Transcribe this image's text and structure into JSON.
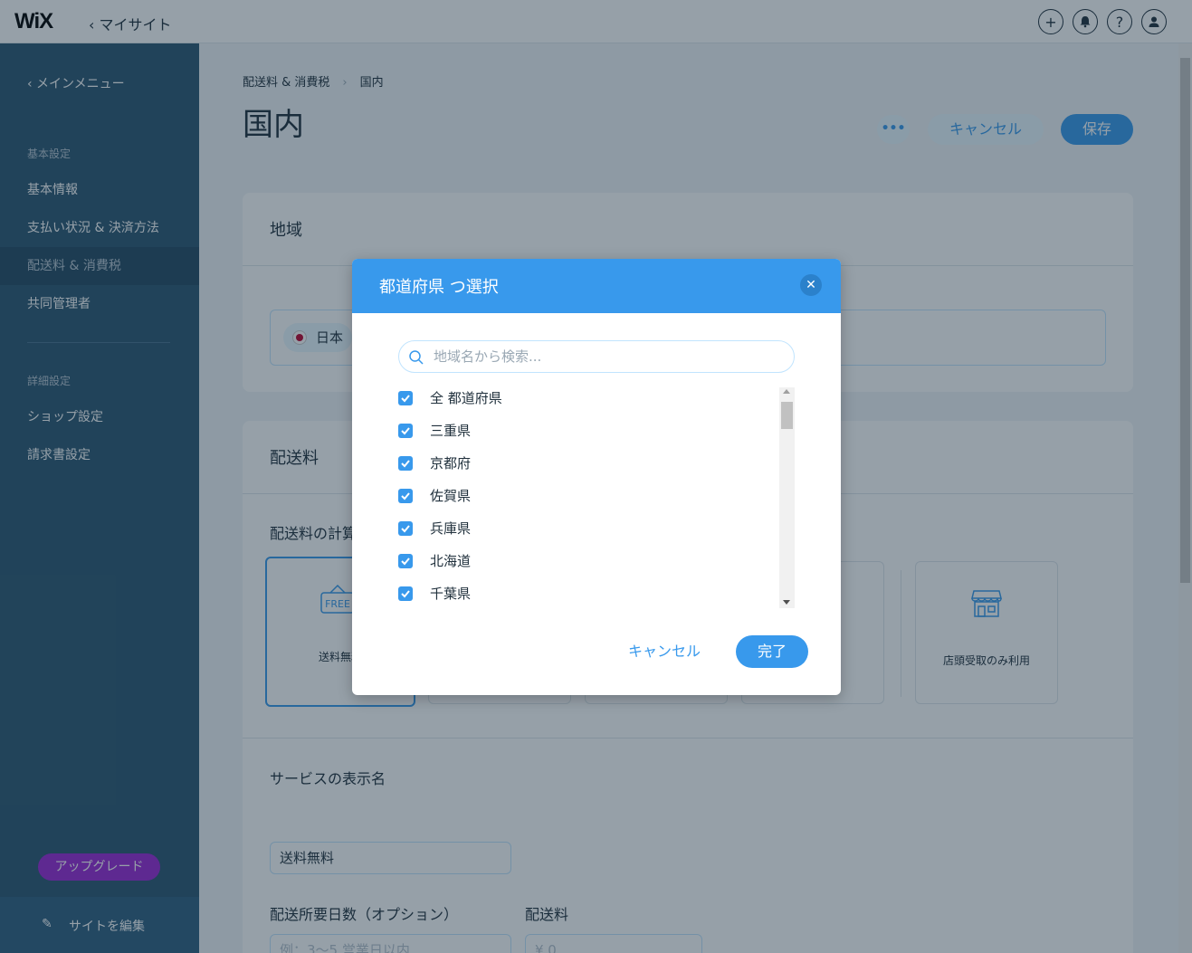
{
  "topbar": {
    "logo": "WiX",
    "mysite": "‹ マイサイト",
    "icons": [
      "plus-icon",
      "bell-icon",
      "help-icon",
      "user-icon"
    ]
  },
  "sidebar": {
    "back": "‹  メインメニュー",
    "section_basic": "基本設定",
    "items": [
      {
        "label": "基本情報"
      },
      {
        "label": "支払い状況 & 決済方法"
      },
      {
        "label": "配送料 & 消費税"
      },
      {
        "label": "共同管理者"
      }
    ],
    "section_advanced": "詳細設定",
    "items_advanced": [
      {
        "label": "ショップ設定"
      },
      {
        "label": "請求書設定"
      }
    ],
    "upgrade": "アップグレード",
    "edit_site": "サイトを編集"
  },
  "main": {
    "breadcrumb_parent": "配送料 & 消費税",
    "breadcrumb_current": "国内",
    "title": "国内",
    "more": "•••",
    "cancel": "キャンセル",
    "save": "保存",
    "region_title": "地域",
    "region_chip": "日本",
    "shipping_title": "配送料",
    "calc_label": "配送料の計算",
    "options": [
      {
        "label": "送料無料"
      },
      {
        "label": "店頭受取のみ利用"
      }
    ],
    "service_name_label": "サービスの表示名",
    "service_name_value": "送料無料",
    "delivery_days_label": "配送所要日数（オプション）",
    "delivery_days_placeholder": "例：3〜5 営業日以内",
    "fee_label": "配送料",
    "fee_placeholder": "¥  0"
  },
  "modal": {
    "title": "都道府県 つ選択",
    "search_placeholder": "地域名から検索...",
    "items": [
      {
        "label": "全 都道府県",
        "checked": true
      },
      {
        "label": "三重県",
        "checked": true
      },
      {
        "label": "京都府",
        "checked": true
      },
      {
        "label": "佐賀県",
        "checked": true
      },
      {
        "label": "兵庫県",
        "checked": true
      },
      {
        "label": "北海道",
        "checked": true
      },
      {
        "label": "千葉県",
        "checked": true
      }
    ],
    "cancel": "キャンセル",
    "done": "完了"
  },
  "colors": {
    "accent": "#3899ec",
    "sidebar": "#2b5672",
    "upgrade": "#9a27d5"
  }
}
